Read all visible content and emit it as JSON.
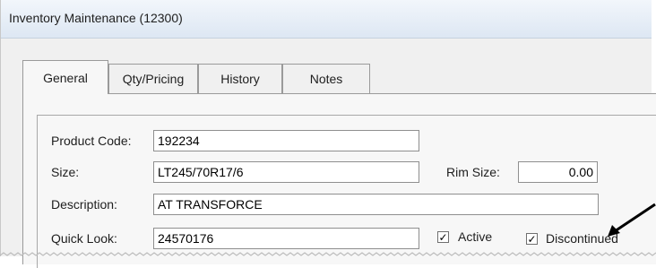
{
  "window": {
    "title": "Inventory Maintenance (12300)"
  },
  "tabs": [
    {
      "label": "General"
    },
    {
      "label": "Qty/Pricing"
    },
    {
      "label": "History"
    },
    {
      "label": "Notes"
    }
  ],
  "form": {
    "product_code": {
      "label": "Product Code:",
      "value": "192234"
    },
    "size": {
      "label": "Size:",
      "value": "LT245/70R17/6"
    },
    "rim_size": {
      "label": "Rim Size:",
      "value": "0.00"
    },
    "description": {
      "label": "Description:",
      "value": "AT TRANSFORCE"
    },
    "quick_look": {
      "label": "Quick Look:",
      "value": "24570176"
    },
    "active": {
      "label": "Active",
      "checked": true
    },
    "discontinued": {
      "label": "Discontinued",
      "checked": true
    }
  },
  "colors": {
    "title_bar": "#dde7f3",
    "panel": "#f7f7f7",
    "window": "#f0f0f0"
  }
}
